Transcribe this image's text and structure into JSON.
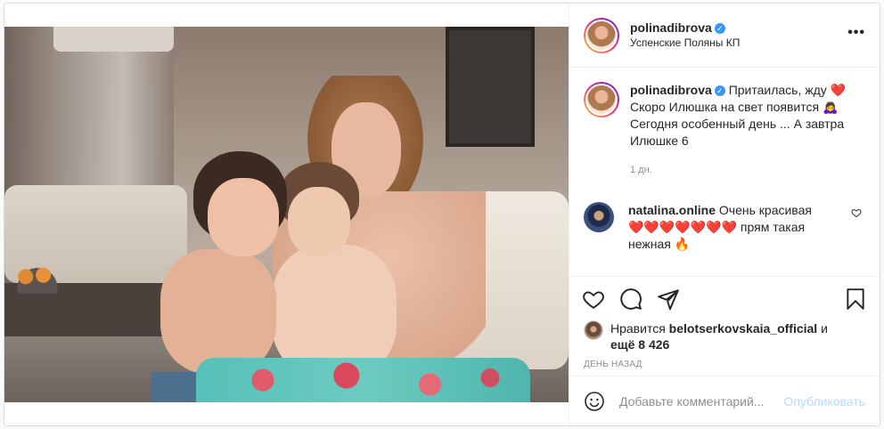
{
  "post": {
    "username": "polinadibrova",
    "location": "Успенские Поляны КП",
    "more_label": "•••"
  },
  "caption": {
    "username": "polinadibrova",
    "text": "Притаилась, жду ❤️\nСкоро Илюшка на свет появится 🙇‍♀️\nСегодня особенный день ... А завтра\nИлюшке 6",
    "time": "1 дн."
  },
  "comments": [
    {
      "username": "natalina.online",
      "text": "Очень красивая\n❤️❤️❤️❤️❤️❤️❤️ прям такая\nнежная 🔥"
    }
  ],
  "actions": {
    "icons": [
      "heart-icon",
      "comment-icon",
      "share-icon",
      "bookmark-icon"
    ]
  },
  "likes": {
    "prefix": "Нравится ",
    "user": "belotserkovskaia_official",
    "middle": " и",
    "others": "ещё 8 426"
  },
  "date_label": "ДЕНЬ НАЗАД",
  "add_comment": {
    "placeholder": "Добавьте комментарий...",
    "publish_label": "Опубликовать"
  },
  "colors": {
    "verified": "#3897f0",
    "publish_disabled": "#b3dbff",
    "muted": "#8e8e8e"
  }
}
